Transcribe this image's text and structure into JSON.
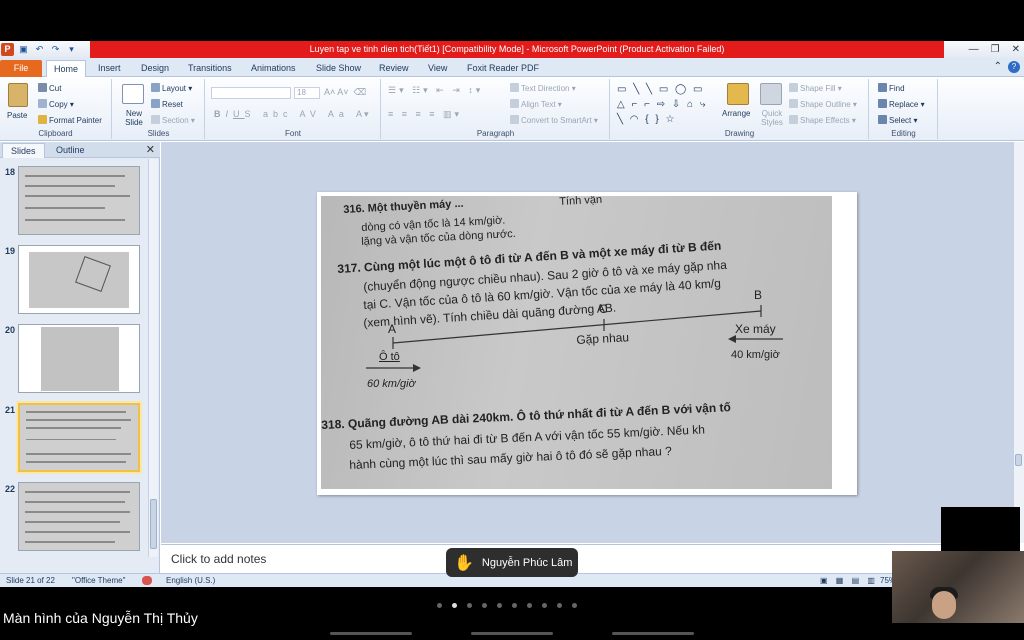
{
  "window": {
    "title": "Luyen tap ve tinh dien tich(Tiết1) [Compatibility Mode] - Microsoft PowerPoint (Product Activation Failed)"
  },
  "ribbon_tabs": [
    "File",
    "Home",
    "Insert",
    "Design",
    "Transitions",
    "Animations",
    "Slide Show",
    "Review",
    "View",
    "Foxit Reader PDF"
  ],
  "clipboard": {
    "paste": "Paste",
    "cut": "Cut",
    "copy": "Copy",
    "format_painter": "Format Painter",
    "label": "Clipboard"
  },
  "slides_group": {
    "new_slide": "New Slide",
    "layout": "Layout",
    "reset": "Reset",
    "section": "Section",
    "label": "Slides"
  },
  "font_group": {
    "size": "18",
    "label": "Font"
  },
  "paragraph_group": {
    "text_direction": "Text Direction",
    "align_text": "Align Text",
    "convert_smartart": "Convert to SmartArt",
    "label": "Paragraph"
  },
  "drawing_group": {
    "arrange": "Arrange",
    "quick_styles": "Quick Styles",
    "shape_fill": "Shape Fill",
    "shape_outline": "Shape Outline",
    "shape_effects": "Shape Effects",
    "label": "Drawing"
  },
  "editing_group": {
    "find": "Find",
    "replace": "Replace",
    "select": "Select",
    "label": "Editing"
  },
  "panel": {
    "tabs": [
      "Slides",
      "Outline"
    ],
    "thumbnails": [
      {
        "num": "18",
        "selected": false
      },
      {
        "num": "19",
        "selected": false
      },
      {
        "num": "20",
        "selected": false
      },
      {
        "num": "21",
        "selected": true
      },
      {
        "num": "22",
        "selected": false
      }
    ]
  },
  "slide_photo": {
    "l1": "316. Một thuyền máy ...",
    "l1b": "Tính vận",
    "l2": "dòng có vận tốc là 14 km/giờ.",
    "l3": "lặng và vận tốc của dòng nước.",
    "l4": "317. Cùng một lúc một ô tô đi từ A đến B và một xe máy đi từ B đến",
    "l5": "(chuyển động ngược chiều nhau). Sau 2 giờ ô tô và xe máy gặp nha",
    "l6": "tại C. Vận tốc của ô tô là 60 km/giờ. Vận tốc của xe máy là 40 km/g",
    "l7": "(xem hình vẽ). Tính chiều dài quãng đường AB.",
    "pt_a": "A",
    "pt_b": "B",
    "pt_c": "C",
    "meet": "Gặp nhau",
    "car": "Ô tô",
    "car_speed": "60 km/giờ",
    "moto": "Xe máy",
    "moto_speed": "40 km/giờ",
    "l8": "318. Quãng đường AB dài 240km. Ô tô thứ nhất đi từ A đến B với vận tố",
    "l9": "65 km/giờ, ô tô thứ hai đi từ B đến A với vận tốc 55 km/giờ. Nếu kh",
    "l10": "hành cùng một lúc thì sau mấy giờ hai ô tô đó sẽ gặp nhau ?"
  },
  "notes": {
    "placeholder": "Click to add notes"
  },
  "status": {
    "slide": "Slide 21 of 22",
    "theme": "\"Office Theme\"",
    "language": "English (U.S.)",
    "zoom": "75%"
  },
  "meeting": {
    "raised_hand_name": "Nguyễn Phúc Lâm",
    "share_label": "Màn hình của Nguyễn Thị Thủy",
    "page_dots": 10,
    "active_dot": 1
  }
}
